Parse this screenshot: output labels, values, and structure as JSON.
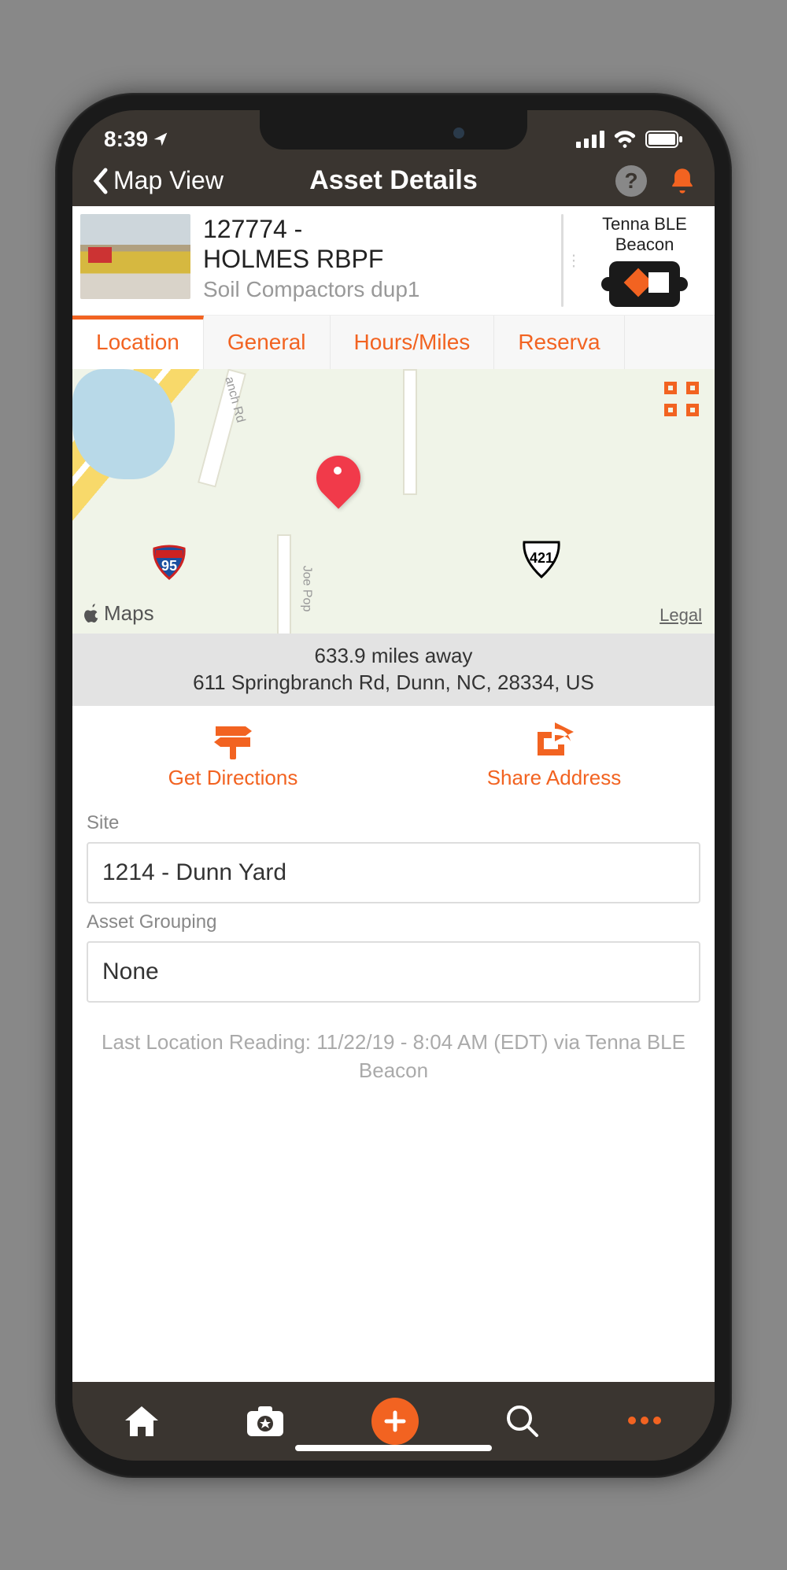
{
  "status": {
    "time": "8:39",
    "location_arrow": "➤"
  },
  "nav": {
    "back_label": "Map View",
    "title": "Asset Details"
  },
  "asset": {
    "title_line1": "127774 -",
    "title_line2": "HOLMES RBPF",
    "subtitle": "Soil Compactors dup1"
  },
  "tracker": {
    "label_line1": "Tenna BLE",
    "label_line2": "Beacon"
  },
  "tabs": [
    {
      "label": "Location",
      "active": true
    },
    {
      "label": "General",
      "active": false
    },
    {
      "label": "Hours/Miles",
      "active": false
    },
    {
      "label": "Reserva",
      "active": false
    }
  ],
  "map": {
    "attribution": "Maps",
    "legal": "Legal",
    "road_labels": {
      "springbranch": "anch Rd",
      "joepope": "Joe Pop"
    },
    "highway_95": "95",
    "highway_421": "421"
  },
  "location": {
    "distance": "633.9 miles away",
    "address": "611 Springbranch Rd, Dunn, NC, 28334, US"
  },
  "actions": {
    "directions": "Get Directions",
    "share": "Share Address"
  },
  "fields": {
    "site_label": "Site",
    "site_value": "1214 - Dunn Yard",
    "grouping_label": "Asset Grouping",
    "grouping_value": "None"
  },
  "last_reading": "Last Location Reading: 11/22/19 - 8:04 AM  (EDT) via Tenna BLE Beacon"
}
